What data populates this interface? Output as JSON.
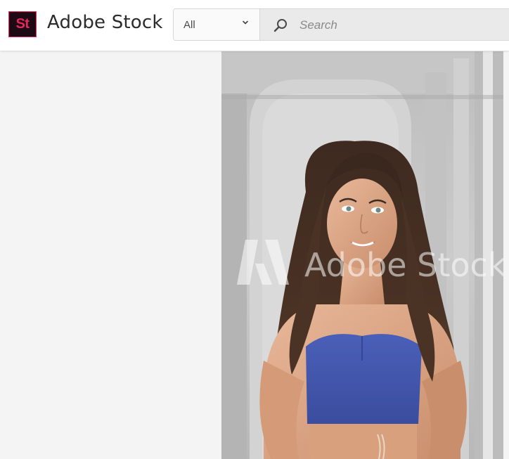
{
  "header": {
    "logo_text": "St",
    "brand_name": "Adobe Stock",
    "brand_color": "#e2285c",
    "logo_bg": "#1e0a15"
  },
  "search": {
    "scope_selected": "All",
    "placeholder": "Search",
    "icon": "search-icon"
  },
  "preview": {
    "watermark_text": "Adobe Stock",
    "alt": "Smiling woman with long brown hair wearing a blue denim crop top"
  }
}
